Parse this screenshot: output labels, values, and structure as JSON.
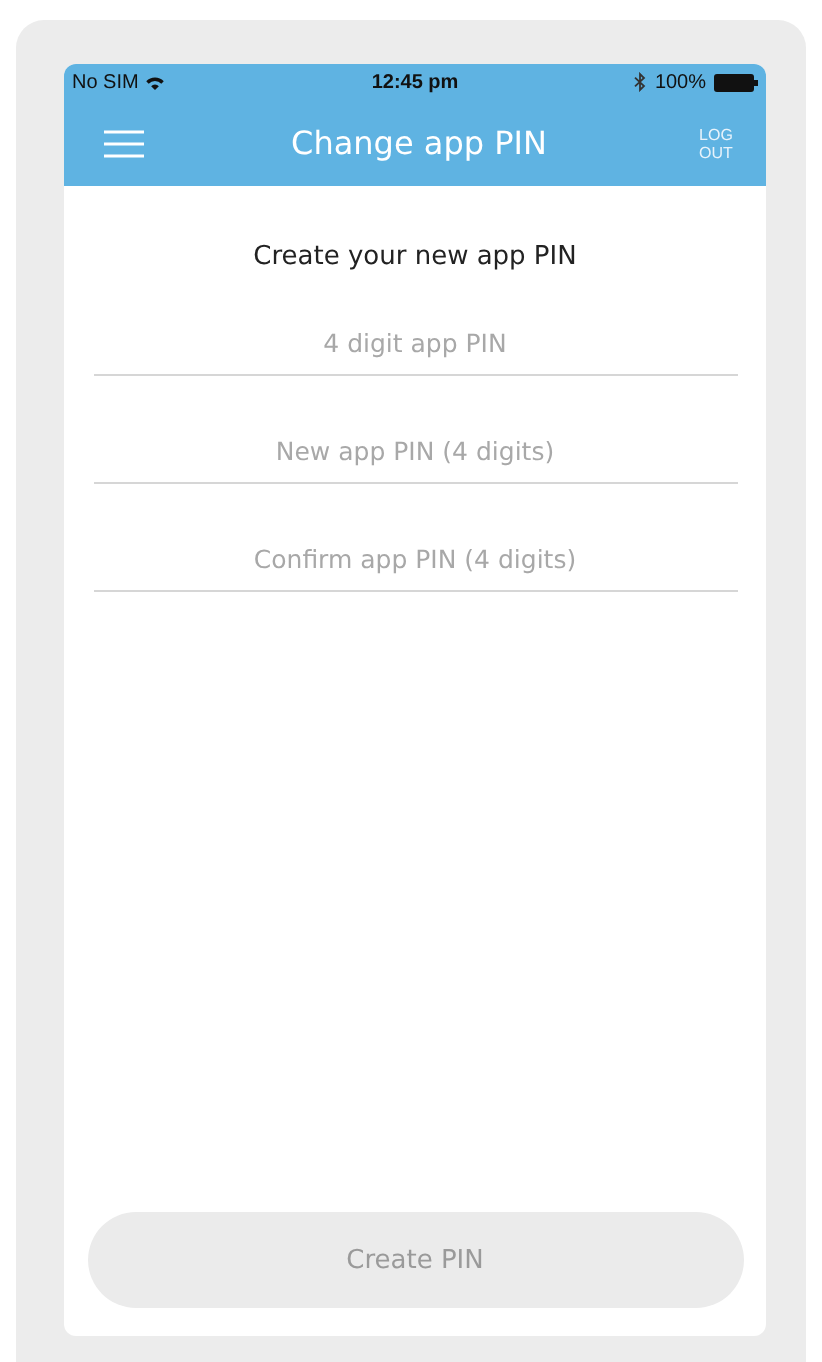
{
  "status_bar": {
    "carrier": "No SIM",
    "time": "12:45 pm",
    "battery": "100%"
  },
  "nav_bar": {
    "title": "Change app PIN",
    "logout": "LOG OUT"
  },
  "heading": "Create your new app PIN",
  "fields": [
    {
      "placeholder": "4 digit app PIN"
    },
    {
      "placeholder": "New app PIN (4 digits)"
    },
    {
      "placeholder": "Confirm app PIN (4 digits)"
    }
  ],
  "button": {
    "label": "Create PIN",
    "disabled": true
  }
}
